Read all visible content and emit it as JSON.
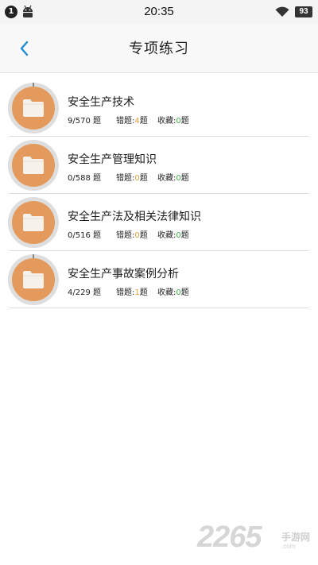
{
  "status_bar": {
    "notification_count": "1",
    "time": "20:35",
    "battery": "93"
  },
  "header": {
    "title": "专项练习"
  },
  "items": [
    {
      "title": "安全生产技术",
      "progress": "9/570",
      "progress_unit": "题",
      "wrong_label": "错题:",
      "wrong_count": "4",
      "wrong_unit": "题",
      "fav_label": "收藏:",
      "fav_count": "0",
      "fav_unit": "题"
    },
    {
      "title": "安全生产管理知识",
      "progress": "0/588",
      "progress_unit": "题",
      "wrong_label": "错题:",
      "wrong_count": "0",
      "wrong_unit": "题",
      "fav_label": "收藏:",
      "fav_count": "0",
      "fav_unit": "题"
    },
    {
      "title": "安全生产法及相关法律知识",
      "progress": "0/516",
      "progress_unit": "题",
      "wrong_label": "错题:",
      "wrong_count": "0",
      "wrong_unit": "题",
      "fav_label": "收藏:",
      "fav_count": "0",
      "fav_unit": "题"
    },
    {
      "title": "安全生产事故案例分析",
      "progress": "4/229",
      "progress_unit": "题",
      "wrong_label": "错题:",
      "wrong_count": "1",
      "wrong_unit": "题",
      "fav_label": "收藏:",
      "fav_count": "0",
      "fav_unit": "题"
    }
  ],
  "watermark": {
    "number": "2265",
    "text": "手游网",
    "url": ".com"
  },
  "colors": {
    "folder_circle": "#e39a5c",
    "wrong_count": "#e2a23b",
    "fav_count": "#3fae47",
    "back_arrow": "#1e8fd5"
  }
}
